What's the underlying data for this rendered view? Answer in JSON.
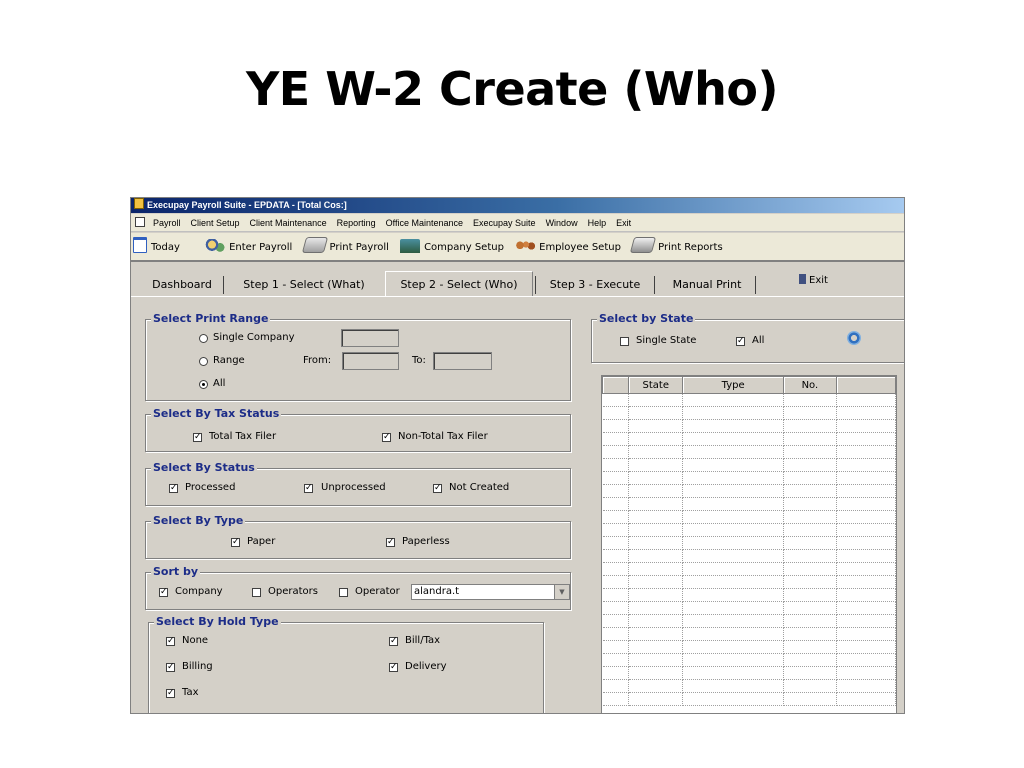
{
  "slide_title": "YE W-2 Create (Who)",
  "window": {
    "title": "Execupay Payroll Suite - EPDATA - [Total Cos:]"
  },
  "menu": [
    "Payroll",
    "Client Setup",
    "Client Maintenance",
    "Reporting",
    "Office Maintenance",
    "Execupay Suite",
    "Window",
    "Help",
    "Exit"
  ],
  "toolbar": {
    "today": "Today",
    "enter_payroll": "Enter Payroll",
    "print_payroll": "Print Payroll",
    "company_setup": "Company Setup",
    "employee_setup": "Employee Setup",
    "print_reports": "Print Reports"
  },
  "tabs": {
    "dashboard": "Dashboard",
    "step1": "Step 1 - Select (What)",
    "step2": "Step 2 - Select (Who)",
    "step3": "Step 3 - Execute",
    "manual_print": "Manual Print",
    "exit": "Exit"
  },
  "print_range": {
    "legend": "Select Print Range",
    "single_company": "Single Company",
    "range": "Range",
    "from": "From:",
    "to": "To:",
    "all": "All",
    "selected": "All"
  },
  "tax_status": {
    "legend": "Select By Tax Status",
    "total": "Total Tax Filer",
    "non_total": "Non-Total Tax Filer"
  },
  "status": {
    "legend": "Select By Status",
    "processed": "Processed",
    "unprocessed": "Unprocessed",
    "not_created": "Not Created"
  },
  "type": {
    "legend": "Select By Type",
    "paper": "Paper",
    "paperless": "Paperless"
  },
  "sort": {
    "legend": "Sort by",
    "company": "Company",
    "operators": "Operators",
    "operator": "Operator",
    "operator_value": "alandra.t"
  },
  "hold_type": {
    "legend": "Select By Hold Type",
    "none": "None",
    "bill_tax": "Bill/Tax",
    "billing": "Billing",
    "delivery": "Delivery",
    "tax": "Tax"
  },
  "state": {
    "legend": "Select by State",
    "single_state": "Single State",
    "all": "All",
    "columns": [
      "State",
      "Type",
      "No."
    ]
  },
  "colors": {
    "legend_text": "#1c2c88",
    "window_bg": "#d4d0c8",
    "titlebar": "#0a246a"
  }
}
